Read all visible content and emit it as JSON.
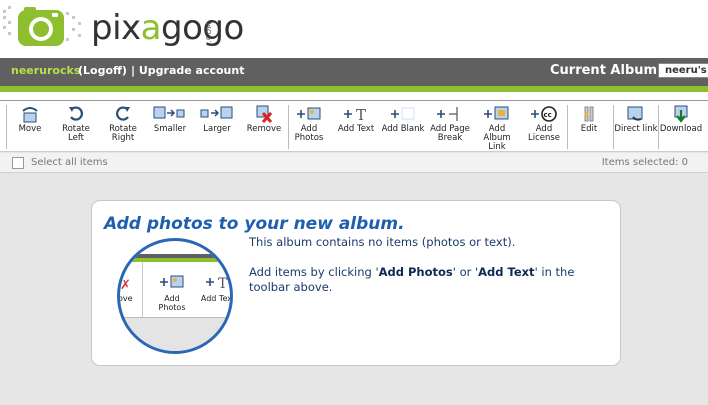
{
  "header": {
    "logo_text_prefix": "pix",
    "logo_text_a": "a",
    "logo_text_suffix": "gogo",
    "logo_com": ".COM"
  },
  "userbar": {
    "username": "neerurocks",
    "logoff": "(Logoff)",
    "upgrade": "| Upgrade account",
    "current_album_label": "Current Album:",
    "current_album_value": "neeru's"
  },
  "toolbar": {
    "items": [
      {
        "label": "Move",
        "icon": "move-icon"
      },
      {
        "label": "Rotate Left",
        "icon": "rotate-left-icon"
      },
      {
        "label": "Rotate Right",
        "icon": "rotate-right-icon"
      },
      {
        "label": "Smaller",
        "icon": "smaller-icon"
      },
      {
        "label": "Larger",
        "icon": "larger-icon"
      },
      {
        "label": "Remove",
        "icon": "remove-icon"
      },
      {
        "label": "Add Photos",
        "icon": "add-photos-icon"
      },
      {
        "label": "Add Text",
        "icon": "add-text-icon"
      },
      {
        "label": "Add Blank",
        "icon": "add-blank-icon"
      },
      {
        "label": "Add Page Break",
        "icon": "add-page-break-icon"
      },
      {
        "label": "Add Album Link",
        "icon": "add-album-link-icon"
      },
      {
        "label": "Add License",
        "icon": "add-license-icon"
      },
      {
        "label": "Edit",
        "icon": "edit-icon"
      },
      {
        "label": "Direct link",
        "icon": "direct-link-icon"
      },
      {
        "label": "Download",
        "icon": "download-icon"
      }
    ]
  },
  "selection": {
    "select_all": "Select all items",
    "items_selected": "Items selected: 0"
  },
  "card": {
    "title": "Add photos to your new album.",
    "line1": "This album contains no items (photos or text).",
    "line2_a": "Add items by clicking '",
    "line2_b": "Add Photos",
    "line2_c": "' or '",
    "line2_d": "Add Text",
    "line2_e": "' in the toolbar above.",
    "zoom_remove": "ove",
    "zoom_add_photos": "Add Photos",
    "zoom_add_text": "Add Text"
  }
}
